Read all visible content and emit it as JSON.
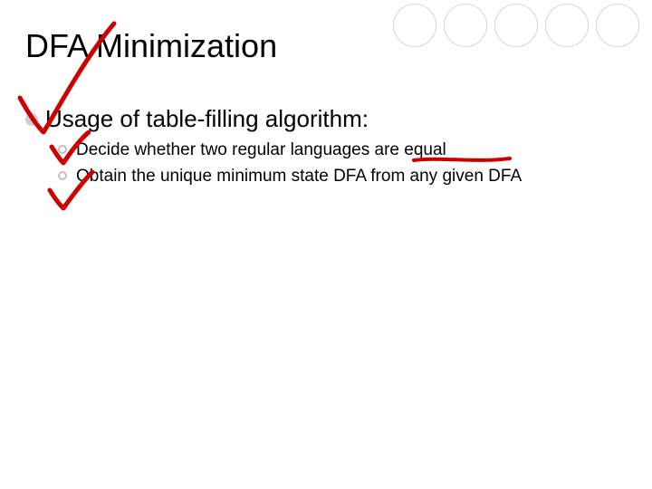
{
  "slide": {
    "title": "DFA Minimization",
    "subhead": "Usage of table-filling algorithm:",
    "items": [
      "Decide whether two regular languages are equal",
      "Obtain the unique minimum state DFA from any given DFA"
    ]
  }
}
